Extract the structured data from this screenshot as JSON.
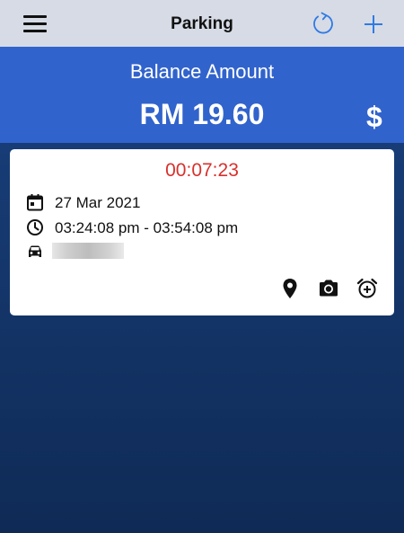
{
  "header": {
    "title": "Parking",
    "menu_icon": "hamburger-menu-icon",
    "refresh_icon": "refresh-icon",
    "add_icon": "plus-icon",
    "accent_color": "#2f7ae5"
  },
  "balance": {
    "label": "Balance Amount",
    "amount": "RM 19.60",
    "currency_icon": "dollar-icon",
    "currency_symbol": "$",
    "background_color": "#3163cc"
  },
  "session": {
    "timer": "00:07:23",
    "timer_color": "#d8302c",
    "date": "27 Mar 2021",
    "time_range": "03:24:08 pm - 03:54:08 pm",
    "vehicle_plate_visible": false,
    "actions": [
      {
        "name": "location-pin-icon"
      },
      {
        "name": "camera-icon"
      },
      {
        "name": "add-alarm-icon"
      }
    ]
  }
}
